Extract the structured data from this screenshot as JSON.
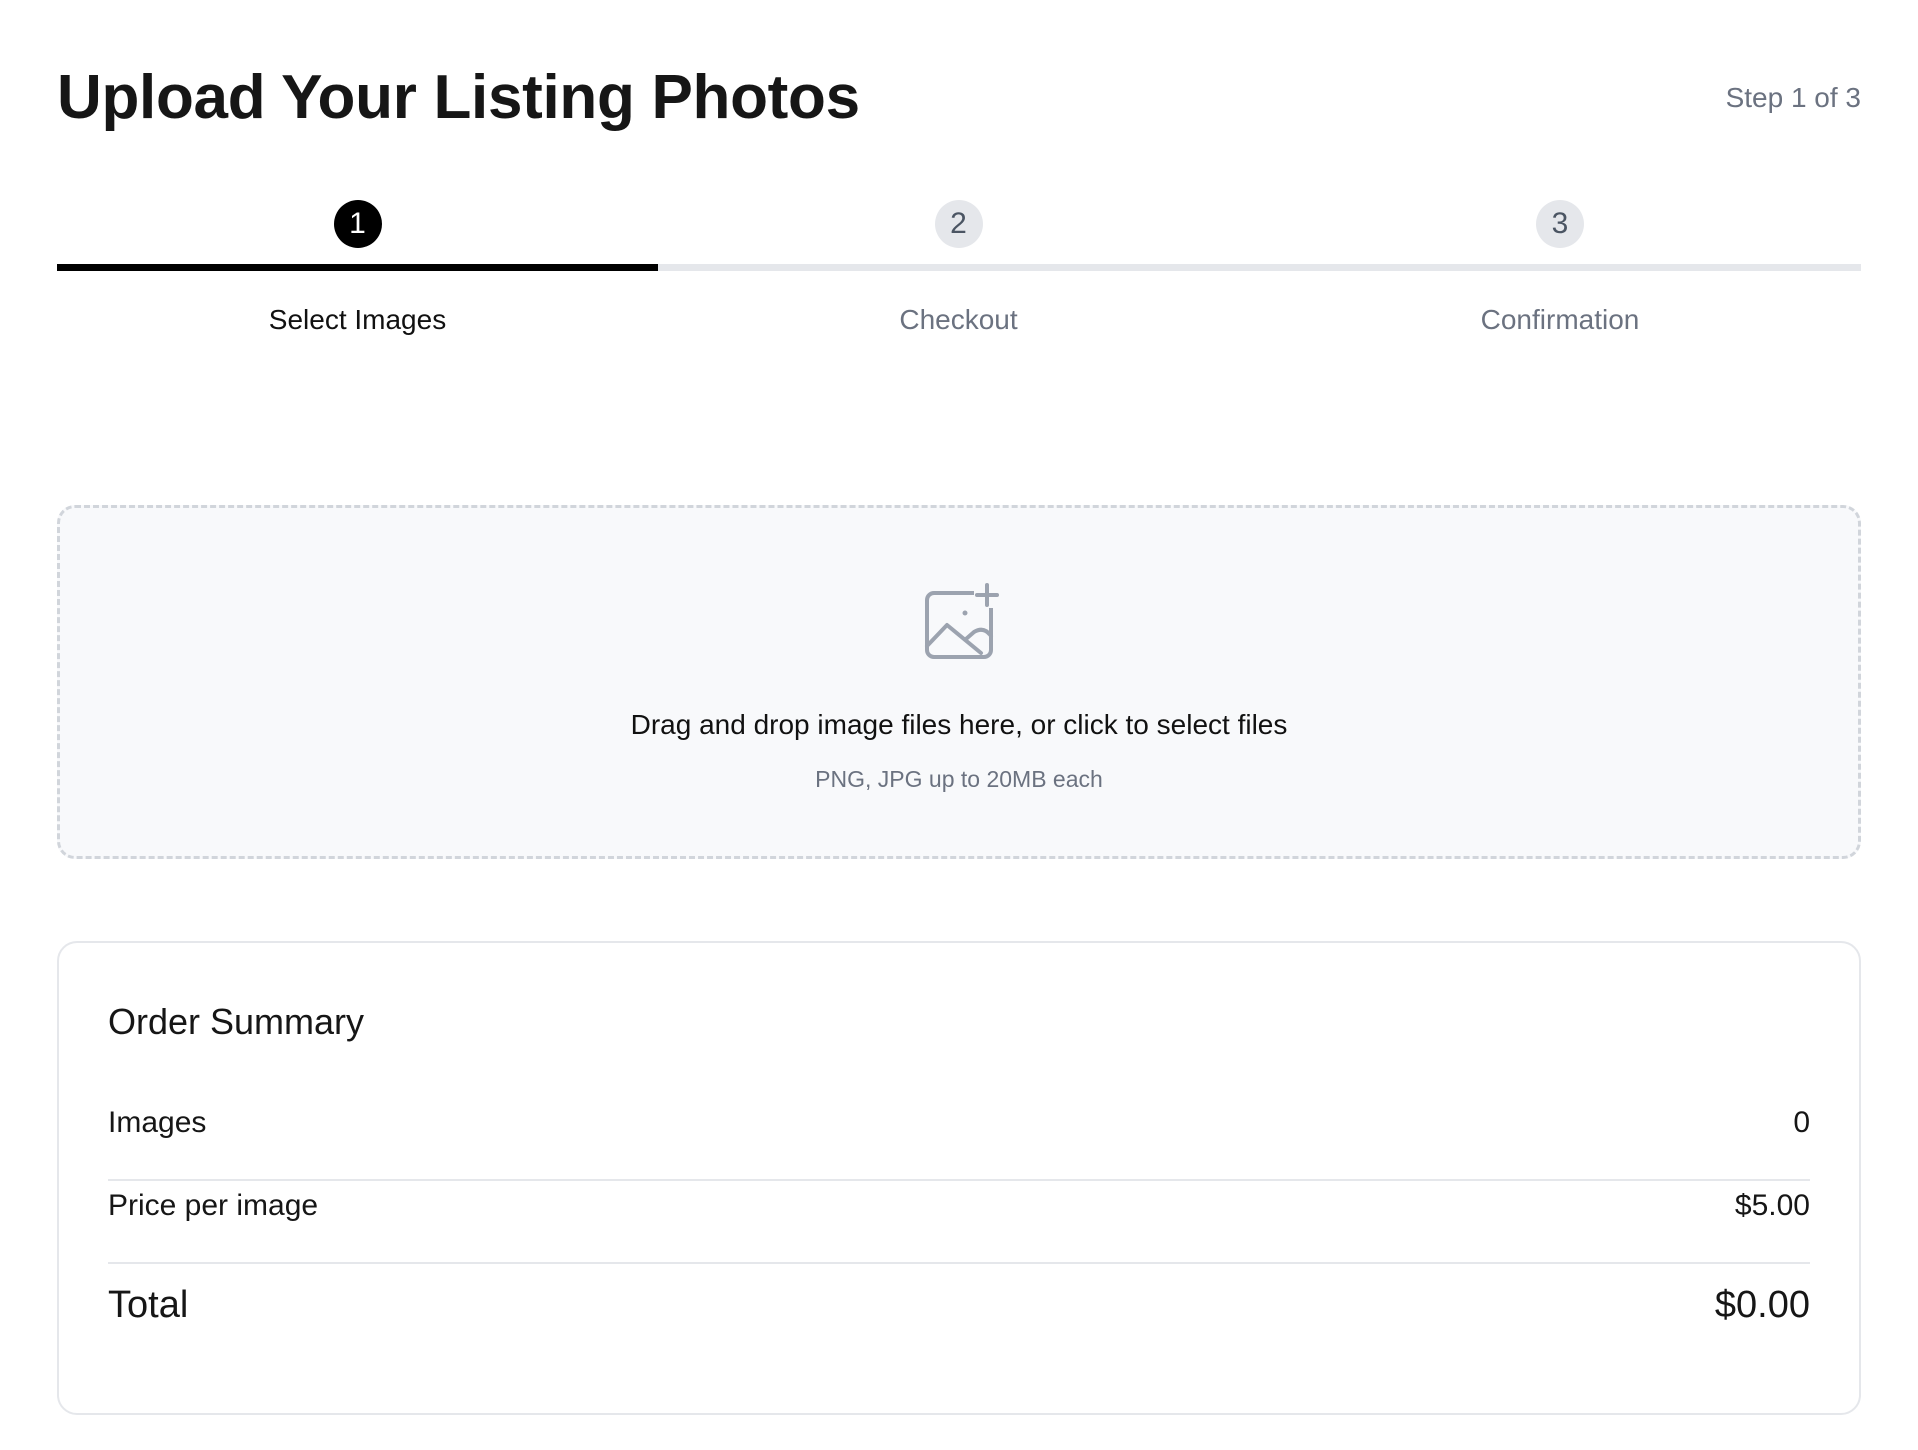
{
  "header": {
    "title": "Upload Your Listing Photos",
    "step_indicator": "Step 1 of 3"
  },
  "stepper": {
    "steps": [
      {
        "number": "1",
        "label": "Select Images",
        "state": "active"
      },
      {
        "number": "2",
        "label": "Checkout",
        "state": "inactive"
      },
      {
        "number": "3",
        "label": "Confirmation",
        "state": "inactive"
      }
    ]
  },
  "dropzone": {
    "icon": "image-plus-icon",
    "instruction": "Drag and drop image files here, or click to select files",
    "hint": "PNG, JPG up to 20MB each"
  },
  "order_summary": {
    "title": "Order Summary",
    "rows": [
      {
        "label": "Images",
        "value": "0"
      },
      {
        "label": "Price per image",
        "value": "$5.00"
      }
    ],
    "total": {
      "label": "Total",
      "value": "$0.00"
    }
  },
  "colors": {
    "accent": "#000000",
    "muted_text": "#6b7280",
    "border": "#e5e7eb",
    "dropzone_bg": "#f8f9fb"
  }
}
